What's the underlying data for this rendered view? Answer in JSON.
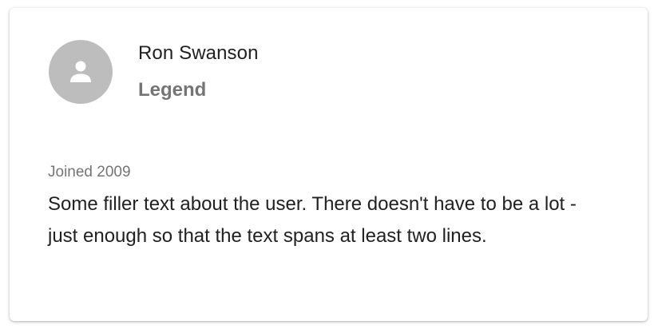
{
  "profile": {
    "avatar_icon": "person-icon",
    "name": "Ron Swanson",
    "title": "Legend",
    "joined": "Joined 2009",
    "bio": "Some filler text about the user. There doesn't have to be a lot - just enough so that the text spans at least two lines."
  },
  "colors": {
    "avatar_bg": "#bdbdbd",
    "primary_text": "#212121",
    "secondary_text": "#757575"
  }
}
